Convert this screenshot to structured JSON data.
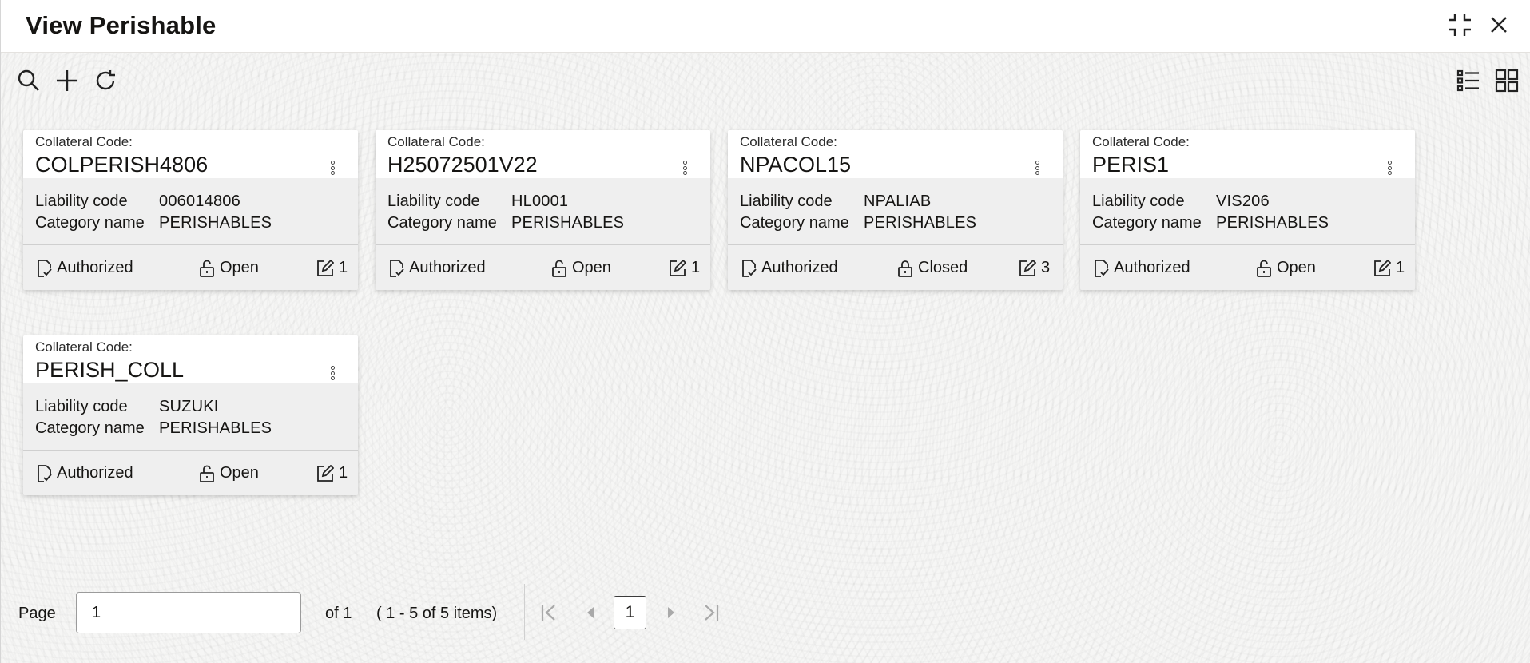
{
  "window": {
    "title": "View Perishable"
  },
  "toolbar": {
    "search_icon": "search-icon",
    "add_icon": "plus-icon",
    "refresh_icon": "refresh-icon",
    "list_view_icon": "list-view-icon",
    "tile_view_icon": "grid-view-icon"
  },
  "labels": {
    "collateral_code": "Collateral Code:",
    "liability_code": "Liability code",
    "category_name": "Category name"
  },
  "cards": [
    {
      "code": "COLPERISH4806",
      "liability": "006014806",
      "category": "PERISHABLES",
      "auth": "Authorized",
      "lock": "Open",
      "edits": "1"
    },
    {
      "code": "H25072501V22",
      "liability": "HL0001",
      "category": "PERISHABLES",
      "auth": "Authorized",
      "lock": "Open",
      "edits": "1"
    },
    {
      "code": "NPACOL15",
      "liability": "NPALIAB",
      "category": "PERISHABLES",
      "auth": "Authorized",
      "lock": "Closed",
      "edits": "3"
    },
    {
      "code": "PERIS1",
      "liability": "VIS206",
      "category": "PERISHABLES",
      "auth": "Authorized",
      "lock": "Open",
      "edits": "1"
    },
    {
      "code": "PERISH_COLL",
      "liability": "SUZUKI",
      "category": "PERISHABLES",
      "auth": "Authorized",
      "lock": "Open",
      "edits": "1"
    }
  ],
  "pager": {
    "page_label": "Page",
    "page_value": "1",
    "of_label": "of 1",
    "items_label": "( 1 - 5 of 5 items)",
    "current_page": "1"
  },
  "colors": {
    "title_bar": "#ffffff",
    "background": "#f6f6f5",
    "card_body": "#efefef",
    "text": "#161513"
  }
}
